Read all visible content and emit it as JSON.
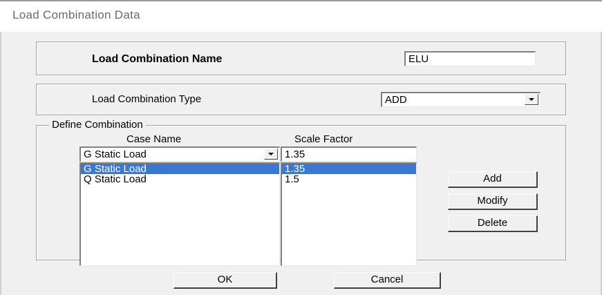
{
  "window": {
    "title": "Load Combination Data"
  },
  "name_group": {
    "label": "Load Combination Name",
    "value": "ELU"
  },
  "type_group": {
    "label": "Load Combination Type",
    "selected": "ADD"
  },
  "define_group": {
    "legend": "Define Combination",
    "case_name_header": "Case Name",
    "scale_factor_header": "Scale Factor",
    "case_combo_value": "G Static Load",
    "scale_input_value": "1.35",
    "case_items": [
      "G Static Load",
      "Q Static Load"
    ],
    "scale_items": [
      "1.35",
      "1.5"
    ],
    "selected_index": 0,
    "add_label": "Add",
    "modify_label": "Modify",
    "delete_label": "Delete"
  },
  "footer": {
    "ok_label": "OK",
    "cancel_label": "Cancel"
  },
  "colors": {
    "selection": "#3a78d6",
    "title_text": "#6a6a6a",
    "dialog_bg": "#f0f0f0"
  }
}
